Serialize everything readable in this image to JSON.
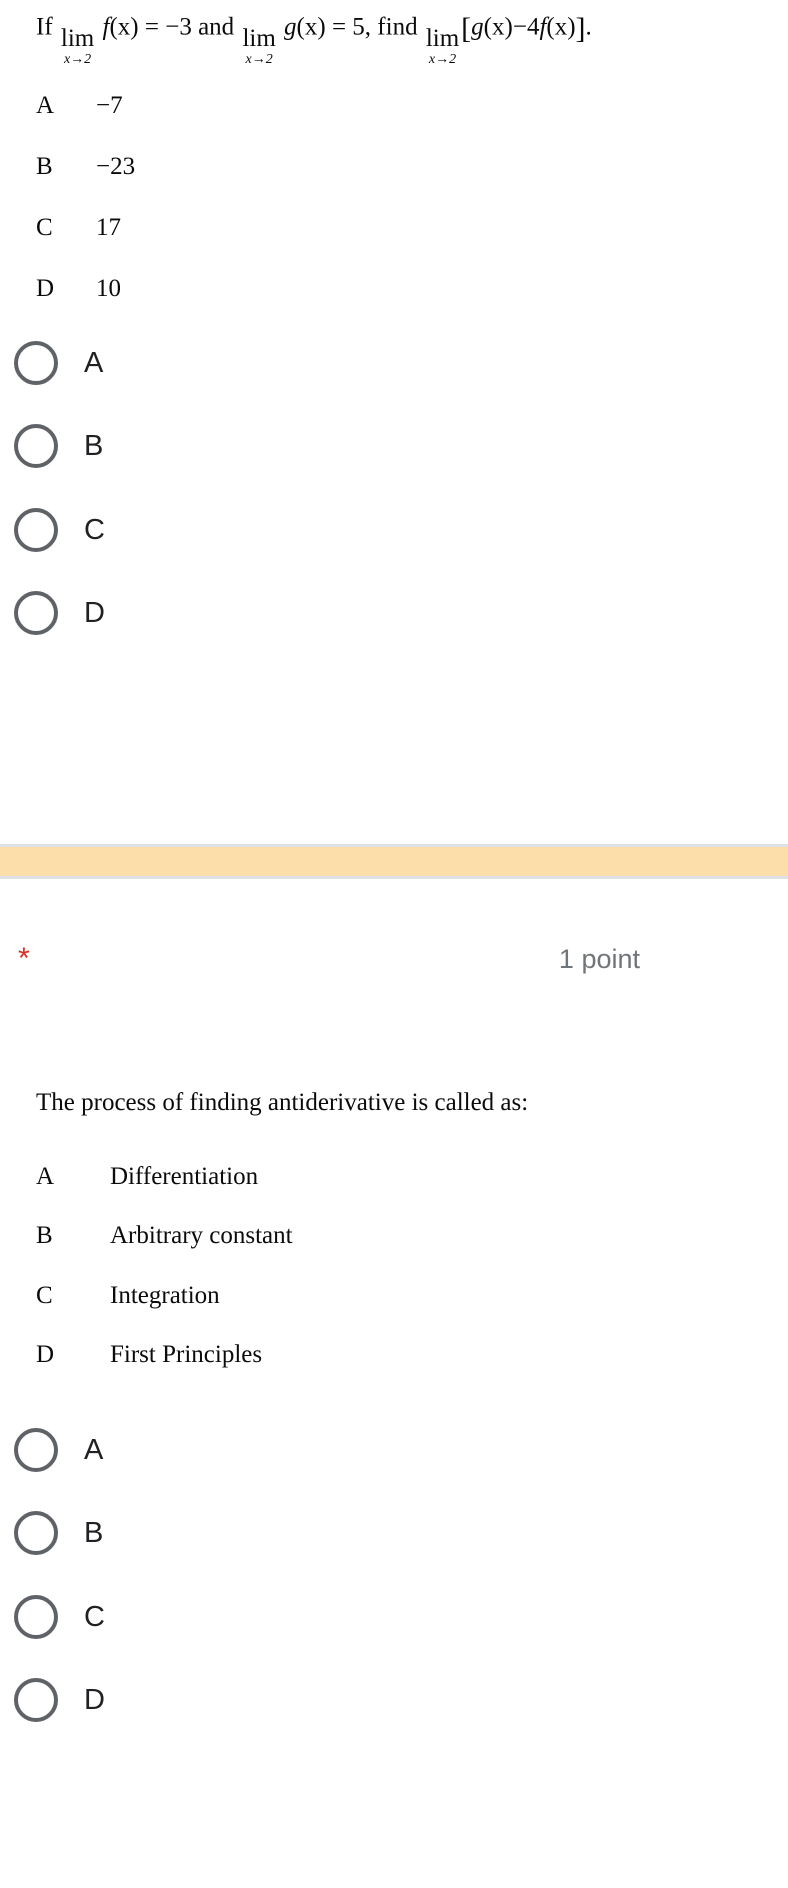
{
  "page": {
    "background_color": "#ffffff",
    "text_color": "#202124"
  },
  "questions": [
    {
      "id": "q1",
      "stem_plain": "If lim(x→2) f(x) = -3 and lim(x→2) g(x) = 5, find lim(x→2)[g(x) - 4f(x)].",
      "stem_parts": {
        "if": "If",
        "lim1_main": "lim",
        "lim1_sub": "x→2",
        "f_fn": "f",
        "f_arg": "(x)",
        "eq1": "=",
        "val1": "−3",
        "and": "and",
        "lim2_main": "lim",
        "lim2_sub": "x→2",
        "g_fn": "g",
        "g_arg": "(x)",
        "eq2": "=",
        "val2": "5",
        "comma": ",",
        "find": "find",
        "lim3_main": "lim",
        "lim3_sub": "x→2",
        "bracket_open": "[",
        "inner_g": "g",
        "inner_g_arg": "(x)",
        "minus": "−",
        "coef": "4",
        "inner_f": "f",
        "inner_f_arg": "(x)",
        "bracket_close": "]",
        "period": "."
      },
      "lettered_options": [
        {
          "letter": "A",
          "text": "−7"
        },
        {
          "letter": "B",
          "text": "−23"
        },
        {
          "letter": "C",
          "text": "17"
        },
        {
          "letter": "D",
          "text": "10"
        }
      ],
      "radio_options": [
        {
          "label": "A",
          "selected": false
        },
        {
          "label": "B",
          "selected": false
        },
        {
          "label": "C",
          "selected": false
        },
        {
          "label": "D",
          "selected": false
        }
      ]
    },
    {
      "id": "q2",
      "required_marker": "*",
      "points_label": "1 point",
      "stem_plain": "The process of finding antiderivative is called as:",
      "lettered_options": [
        {
          "letter": "A",
          "text": "Differentiation"
        },
        {
          "letter": "B",
          "text": "Arbitrary constant"
        },
        {
          "letter": "C",
          "text": "Integration"
        },
        {
          "letter": "D",
          "text": "First Principles"
        }
      ],
      "radio_options": [
        {
          "label": "A",
          "selected": false
        },
        {
          "label": "B",
          "selected": false
        },
        {
          "label": "C",
          "selected": false
        },
        {
          "label": "D",
          "selected": false
        }
      ]
    }
  ],
  "separator": {
    "color": "#fbdeaa",
    "border_color": "#dfe1e8"
  },
  "colors": {
    "required_star": "#d93025",
    "points_text": "#70757a",
    "radio_border": "#5f6368",
    "accent_band": "#fbdeaa"
  }
}
